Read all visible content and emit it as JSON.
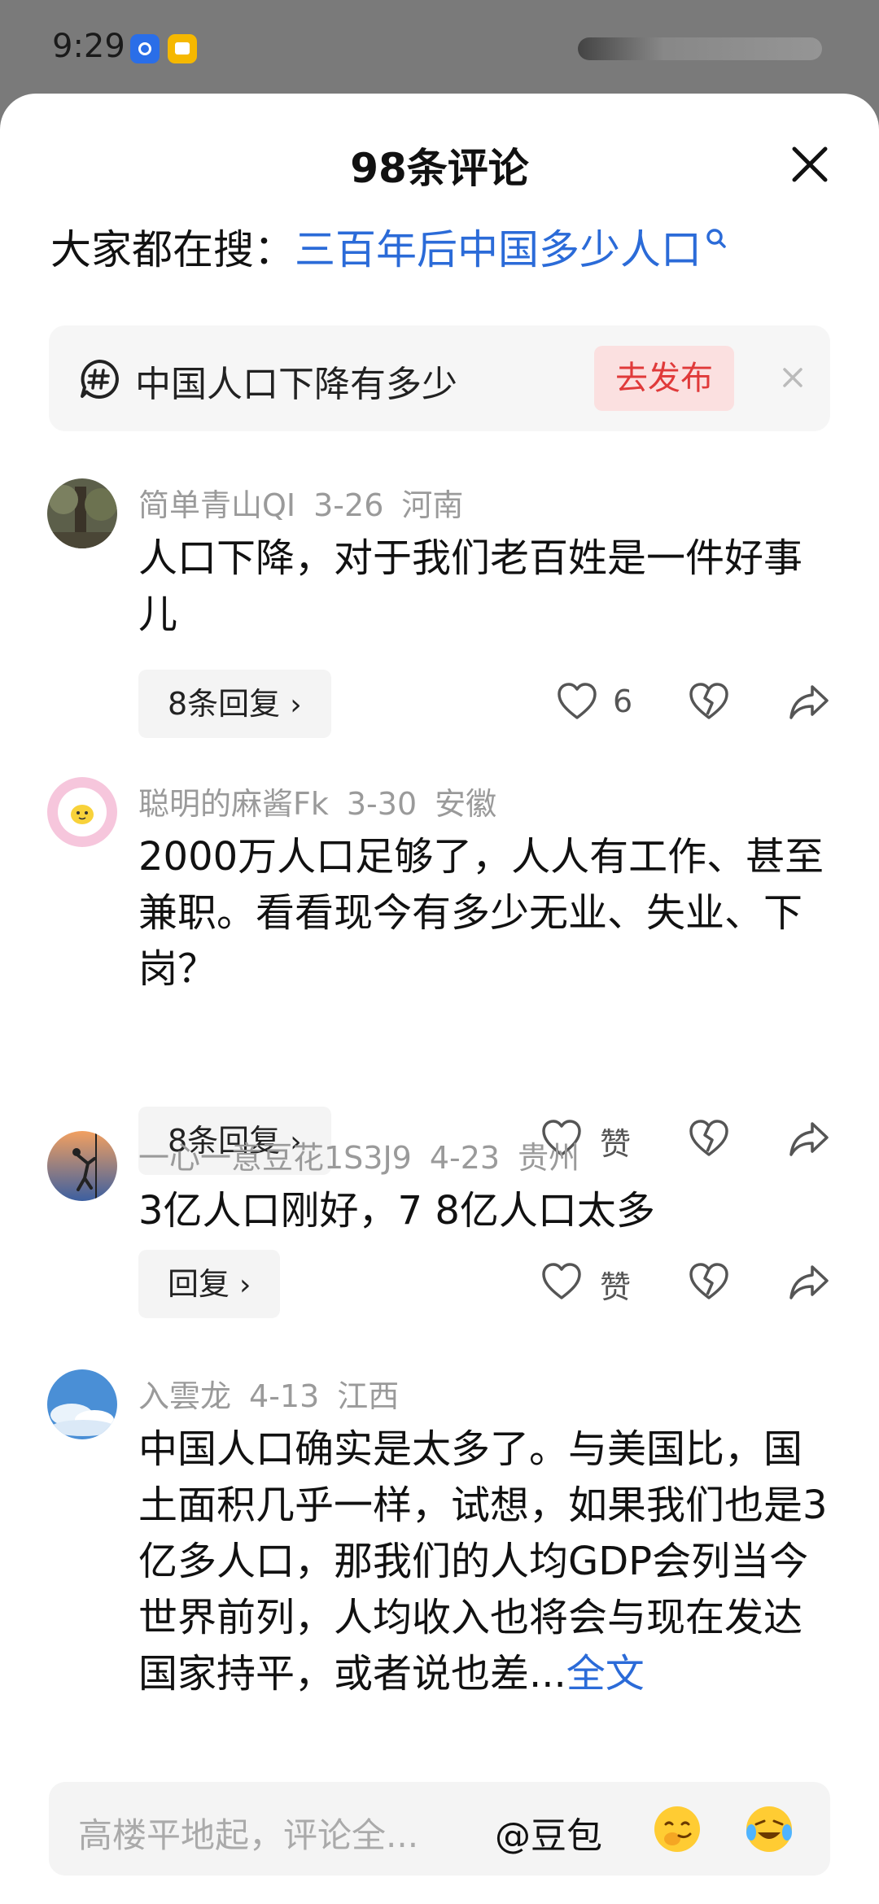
{
  "status_bar": {
    "time": "9:29"
  },
  "header": {
    "title": "98条评论"
  },
  "hot_search": {
    "label": "大家都在搜：",
    "query": "三百年后中国多少人口"
  },
  "topic": {
    "text": "中国人口下降有多少",
    "publish_label": "去发布"
  },
  "comments": [
    {
      "user": "简单青山QI",
      "date": "3-26",
      "location": "河南",
      "text": "人口下降，对于我们老百姓是一件好事儿",
      "replies_label": "8条回复",
      "like_label": "6"
    },
    {
      "user": "聪明的麻酱Fk",
      "date": "3-30",
      "location": "安徽",
      "text": "2000万人口足够了，人人有工作、甚至兼职。看看现今有多少无业、失业、下岗？",
      "replies_label": "8条回复",
      "like_label": "赞"
    },
    {
      "user": "一心一意豆花1S3J9",
      "date": "4-23",
      "location": "贵州",
      "text": "3亿人口刚好，7 8亿人口太多",
      "replies_label": "回复",
      "like_label": "赞"
    },
    {
      "user": "入雲龙",
      "date": "4-13",
      "location": "江西",
      "text": "中国人口确实是太多了。与美国比，国土面积几乎一样，试想，如果我们也是3亿多人口，那我们的人均GDP会列当今世界前列，人均收入也将会与现在发达国家持平，或者说也差...",
      "more_label": "全文"
    }
  ],
  "input_bar": {
    "placeholder": "高楼平地起，评论全...",
    "mention": "@豆包"
  },
  "icons": [
    "search-icon",
    "close-icon",
    "hashtag-icon",
    "heart-icon",
    "broken-heart-icon",
    "share-icon",
    "chevron-right-icon",
    "emoji-icon"
  ],
  "colors": {
    "link": "#2b6bd8",
    "publish_bg": "#fbe0e0",
    "publish_text": "#e03a3a",
    "meta": "#9a9a9a"
  }
}
